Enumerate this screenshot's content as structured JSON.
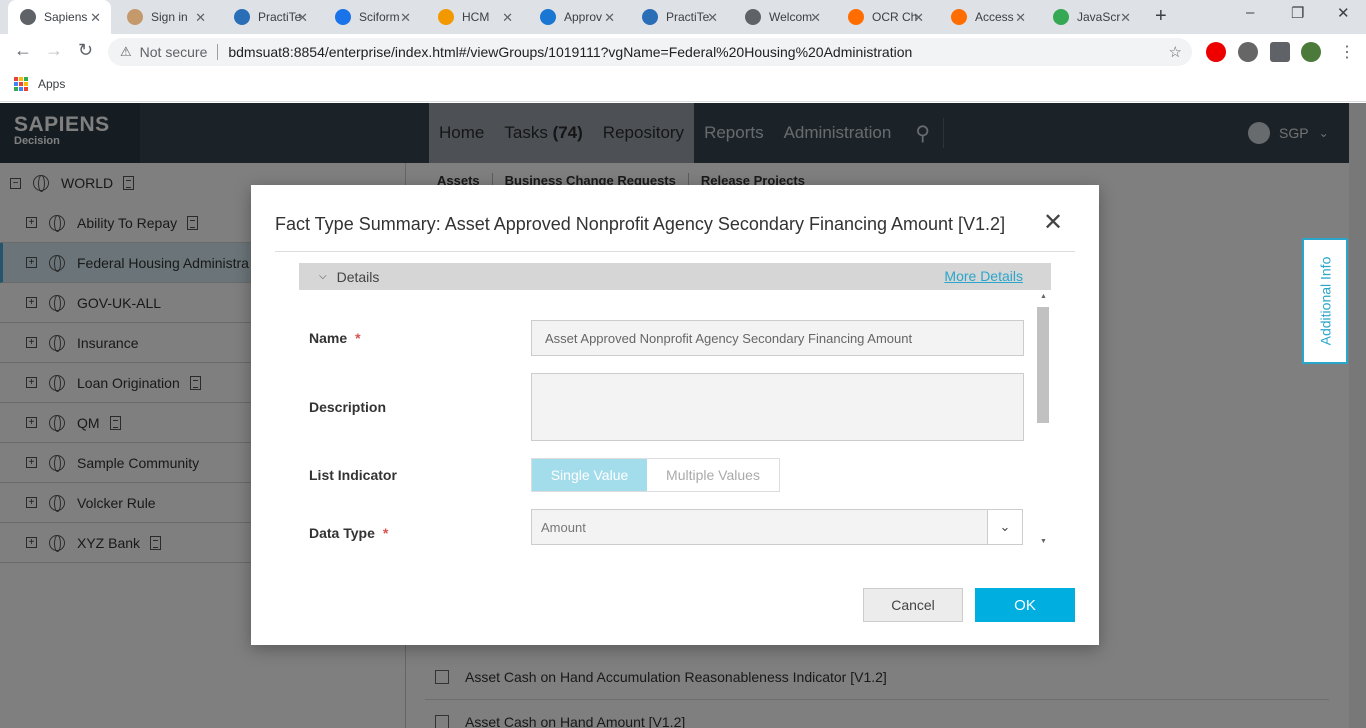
{
  "browser": {
    "tabs": [
      {
        "label": "Sapiens",
        "color": "#5f6368",
        "active": true
      },
      {
        "label": "Sign in",
        "color": "#c49a6c"
      },
      {
        "label": "PractiTe",
        "color": "#2a6eb8"
      },
      {
        "label": "Sciform",
        "color": "#1a73e8"
      },
      {
        "label": "HCM",
        "color": "#f29900"
      },
      {
        "label": "Approv",
        "color": "#1976d2"
      },
      {
        "label": "PractiTe",
        "color": "#2a6eb8"
      },
      {
        "label": "Welcom",
        "color": "#5f6368"
      },
      {
        "label": "OCR Ch",
        "color": "#ff6d00"
      },
      {
        "label": "Access",
        "color": "#ff6d00"
      },
      {
        "label": "JavaScr",
        "color": "#34a853"
      }
    ],
    "security_label": "Not secure",
    "url": "bdmsuat8:8854/enterprise/index.html#/viewGroups/1019111?vgName=Federal%20Housing%20Administration",
    "bookmarks_apps": "Apps"
  },
  "app": {
    "logo_main": "SAPIENS",
    "logo_sub": "Decision",
    "nav": {
      "home": "Home",
      "tasks": "Tasks",
      "tasks_count": "(74)",
      "repository": "Repository",
      "reports": "Reports",
      "administration": "Administration"
    },
    "user": "SGP",
    "subnav": [
      "Assets",
      "Business Change Requests",
      "Release Projects"
    ],
    "additional_info": "Additional Info"
  },
  "tree": {
    "root": "WORLD",
    "items": [
      {
        "label": "Ability To Repay",
        "doc": true
      },
      {
        "label": "Federal Housing Administra",
        "doc": false,
        "selected": true
      },
      {
        "label": "GOV-UK-ALL",
        "doc": false
      },
      {
        "label": "Insurance",
        "doc": false
      },
      {
        "label": "Loan Origination",
        "doc": true
      },
      {
        "label": "QM",
        "doc": true
      },
      {
        "label": "Sample Community",
        "doc": false
      },
      {
        "label": "Volcker Rule",
        "doc": false
      },
      {
        "label": "XYZ Bank",
        "doc": true
      }
    ]
  },
  "content_rows": [
    "Asset Cash on Hand Accumulation Reasonableness Indicator [V1.2]",
    "Asset Cash on Hand Amount [V1.2]"
  ],
  "modal": {
    "title": "Fact Type Summary: Asset Approved Nonprofit Agency Secondary Financing Amount [V1.2]",
    "section": "Details",
    "more_details": "More Details",
    "fields": {
      "name_label": "Name",
      "name_value": "Asset Approved Nonprofit Agency Secondary Financing Amount",
      "description_label": "Description",
      "description_value": "",
      "list_indicator_label": "List Indicator",
      "single_value": "Single Value",
      "multiple_values": "Multiple Values",
      "data_type_label": "Data Type",
      "data_type_value": "Amount"
    },
    "required_mark": "*",
    "cancel": "Cancel",
    "ok": "OK"
  }
}
